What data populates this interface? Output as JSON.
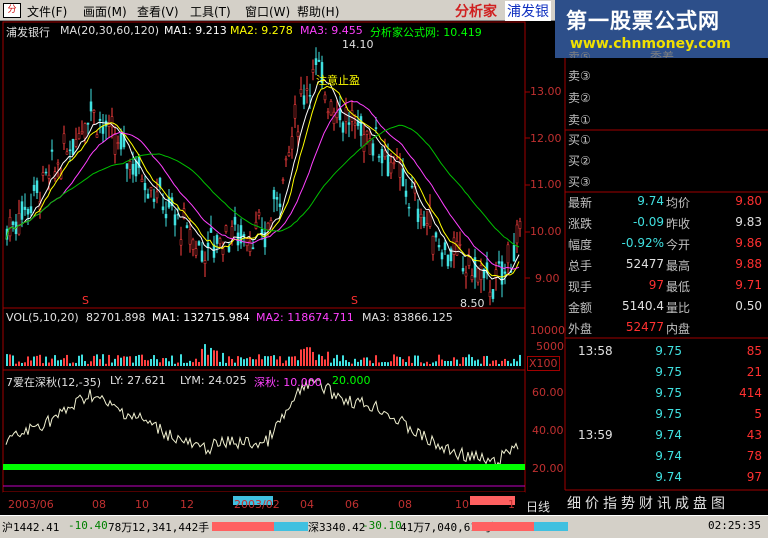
{
  "menu": {
    "items": [
      "文件(F)",
      "画面(M)",
      "查看(V)",
      "工具(T)",
      "窗口(W)",
      "帮助(H)"
    ],
    "brand": "分析家",
    "stock_tab": "浦发银"
  },
  "logo": {
    "title": "第一股票公式网",
    "url": "www.chnmoney.com"
  },
  "price_panel": {
    "stock_name": "浦发银行",
    "ma_label": "MA(20,30,60,120)",
    "ma1": "MA1: 9.213",
    "ma2": "MA2: 9.278",
    "ma3": "MA3: 9.455",
    "formula": "分析家公式网: 10.419",
    "high_mark": "14.10",
    "low_mark": "8.50",
    "annotation": "注意止盈",
    "y_ticks": [
      "13.00",
      "12.00",
      "11.00",
      "10.00",
      "9.00"
    ],
    "s_marks": [
      "S",
      "S"
    ]
  },
  "vol_panel": {
    "label": "VOL(5,10,20)",
    "v0": "82701.898",
    "ma1": "MA1: 132715.984",
    "ma2": "MA2: 118674.711",
    "ma3": "MA3: 83866.125",
    "y_ticks": [
      "10000",
      "5000"
    ],
    "unit": "X100"
  },
  "ind_panel": {
    "label": "7爱在深秋(12,-35)",
    "ly": "LY: 27.621",
    "lym": "LYM: 24.025",
    "deep": "深秋: 10.000",
    "v20": "20.000",
    "y_ticks": [
      "60.00",
      "40.00",
      "20.00"
    ]
  },
  "x_axis": {
    "labels": [
      "2003/06",
      "08",
      "10",
      "12",
      "2003/02",
      "04",
      "06",
      "08",
      "10",
      "1"
    ],
    "period": "日线"
  },
  "order_book": {
    "partial_top": [
      "卖⑤",
      "委差"
    ],
    "sells": [
      "卖③",
      "卖②",
      "卖①"
    ],
    "buys": [
      "买①",
      "买②",
      "买③"
    ]
  },
  "quote": {
    "rows": [
      {
        "l": "最新",
        "lv": "9.74",
        "r": "均价",
        "rv": "9.80"
      },
      {
        "l": "涨跌",
        "lv": "-0.09",
        "r": "昨收",
        "rv": "9.83"
      },
      {
        "l": "幅度",
        "lv": "-0.92%",
        "r": "今开",
        "rv": "9.86"
      },
      {
        "l": "总手",
        "lv": "52477",
        "r": "最高",
        "rv": "9.88"
      },
      {
        "l": "现手",
        "lv": "97",
        "r": "最低",
        "rv": "9.71"
      },
      {
        "l": "金额",
        "lv": "5140.4",
        "r": "量比",
        "rv": "0.50"
      },
      {
        "l": "外盘",
        "lv": "52477",
        "r": "内盘",
        "rv": ""
      }
    ]
  },
  "ticks": [
    {
      "t": "13:58",
      "p": "9.75",
      "v": "85"
    },
    {
      "t": "",
      "p": "9.75",
      "v": "21"
    },
    {
      "t": "",
      "p": "9.75",
      "v": "414"
    },
    {
      "t": "",
      "p": "9.75",
      "v": "5"
    },
    {
      "t": "13:59",
      "p": "9.74",
      "v": "43"
    },
    {
      "t": "",
      "p": "9.74",
      "v": "78"
    },
    {
      "t": "",
      "p": "9.74",
      "v": "97"
    }
  ],
  "side_tabs": [
    "细",
    "价",
    "指",
    "势",
    "财",
    "讯",
    "成",
    "盘",
    "图"
  ],
  "status": {
    "sh": "沪1442.41",
    "sh_chg": "-10.40",
    "sh_amt": "78万",
    "sh_vol": "12,341,442手",
    "sz": "深3340.42",
    "sz_chg": "-30.10",
    "sz_amt": "41万",
    "sz_vol": "7,040,610手",
    "time": "02:25:35"
  },
  "colors": {
    "ma1": "#ffffff",
    "ma2": "#ffff00",
    "ma3": "#ff40ff",
    "ma4": "#00c000",
    "green_band": "#00ff00",
    "red": "#ff3030",
    "cyan": "#40e0e0"
  }
}
